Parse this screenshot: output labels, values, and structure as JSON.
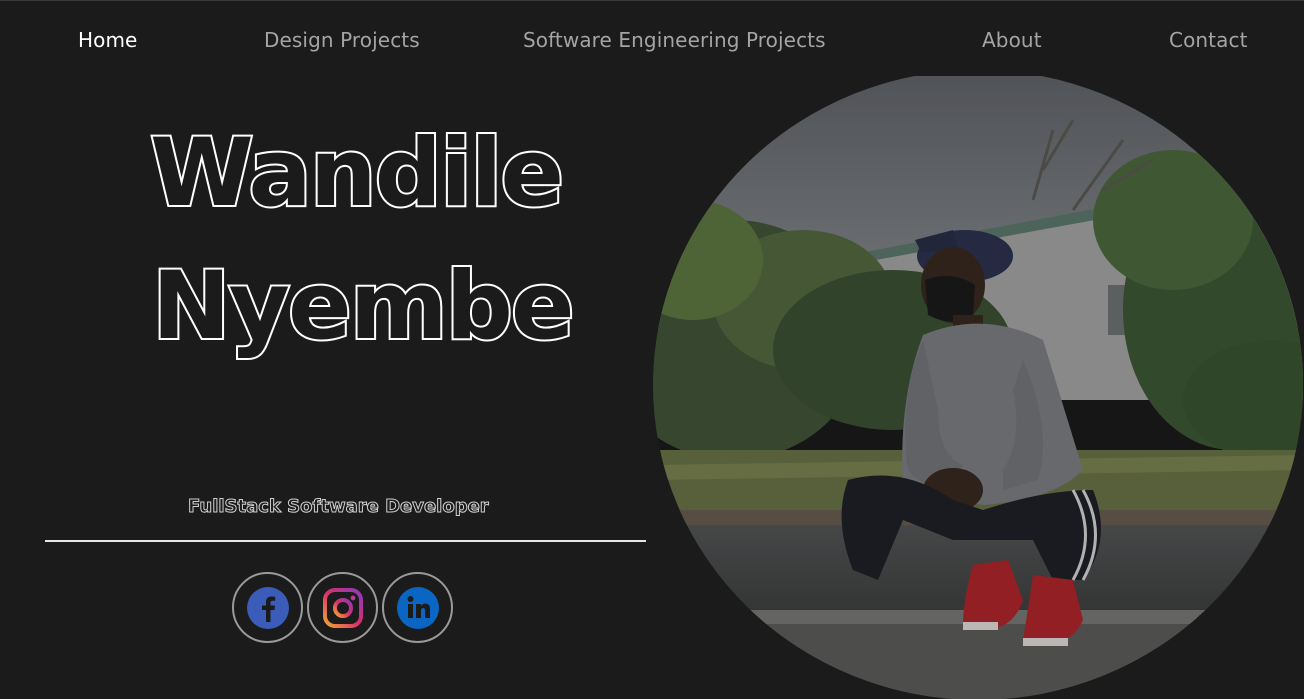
{
  "nav": {
    "items": [
      {
        "label": "Home",
        "active": true
      },
      {
        "label": "Design Projects",
        "active": false
      },
      {
        "label": "Software Engineering Projects",
        "active": false
      },
      {
        "label": "About",
        "active": false
      },
      {
        "label": "Contact",
        "active": false
      }
    ]
  },
  "hero": {
    "first_name": "Wandile",
    "last_name": "Nyembe",
    "role": "FullStack Software Developer"
  },
  "social": [
    {
      "icon": "facebook-icon",
      "color": "#3b5cb8"
    },
    {
      "icon": "instagram-icon",
      "color": "#c13584"
    },
    {
      "icon": "linkedin-icon",
      "color": "#0a66c2"
    }
  ],
  "colors": {
    "background": "#1b1b1b",
    "nav_active": "#ffffff",
    "nav_inactive": "#a4a4a4",
    "outline": "#ffffff"
  }
}
